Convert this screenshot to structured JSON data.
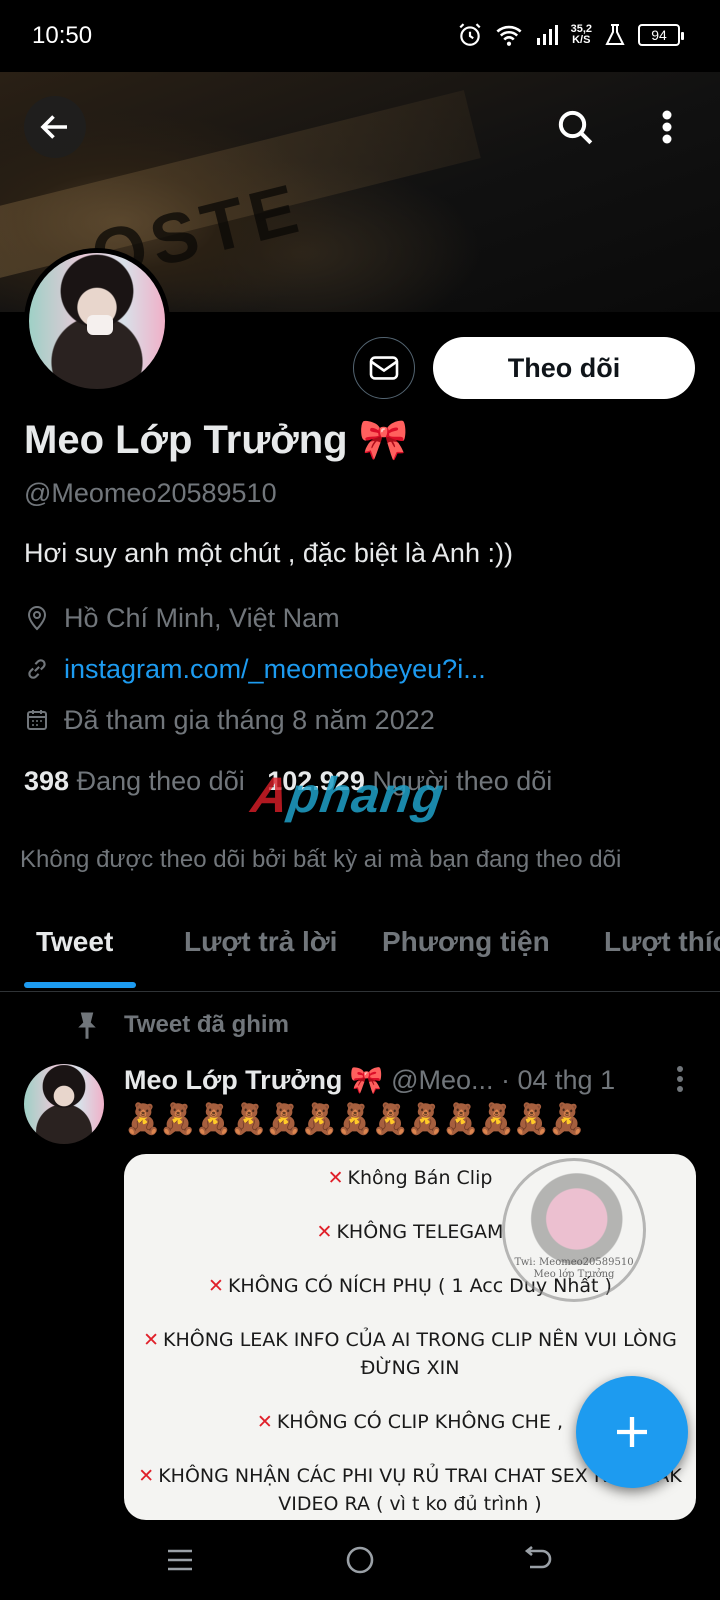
{
  "status_bar": {
    "time": "10:50",
    "net_speed_value": "35,2",
    "net_speed_unit": "K/S",
    "battery": "94",
    "icons": [
      "alarm-icon",
      "wifi-icon",
      "signal-icon",
      "flask-icon",
      "battery-icon"
    ]
  },
  "header": {
    "banner_text": "OSTE",
    "back_icon": "arrow-left-icon",
    "search_icon": "search-icon",
    "more_icon": "more-vertical-icon"
  },
  "profile": {
    "name": "Meo Lớp Trưởng 🎀",
    "handle": "@Meomeo20589510",
    "bio": "Hơi suy anh một chút , đặc biệt là Anh :))",
    "location": "Hồ Chí Minh, Việt Nam",
    "link": "instagram.com/_meomeobeyeu?i...",
    "joined": "Đã tham gia tháng 8 năm 2022",
    "following_count": "398",
    "following_label": "Đang theo dõi",
    "followers_count": "102.929",
    "followers_label": "Người theo dõi",
    "not_followed_note": "Không được theo dõi bởi bất kỳ ai mà bạn đang theo dõi",
    "follow_button": "Theo dõi"
  },
  "watermark": {
    "part1": "A",
    "part2": "phang"
  },
  "tabs": [
    {
      "label": "Tweet",
      "active": true
    },
    {
      "label": "Lượt trả lời",
      "active": false
    },
    {
      "label": "Phương tiện",
      "active": false
    },
    {
      "label": "Lượt thích",
      "active": false
    }
  ],
  "pinned_tweet": {
    "pinned_label": "Tweet đã ghim",
    "author_name": "Meo Lớp Trưởng 🎀",
    "author_handle": "@Meo...",
    "date": "· 04 thg 1",
    "text": "🧸🧸🧸🧸🧸🧸🧸🧸🧸🧸🧸🧸🧸",
    "media_lines": [
      "Không Bán Clip",
      "KHÔNG TELEGAM",
      "KHÔNG CÓ NÍCH PHỤ ( 1 Acc Duy Nhất )",
      "KHÔNG LEAK INFO CỦA AI TRONG CLIP NÊN VUI LÒNG",
      "ĐỪNG XIN",
      "KHÔNG CÓ CLIP KHÔNG CHE ,",
      "KHÔNG NHẬN CÁC PHI VỤ RỦ TRAI CHAT SEX RỒI LEAK",
      "VIDEO RA ( vì t ko đủ trình )"
    ],
    "stamp_line1": "Twi: Meomeo20589510",
    "stamp_line2": "Meo lớp Trưởng"
  },
  "colors": {
    "background": "#000000",
    "accent": "#1d9bf0",
    "text_primary": "#e7e9ea",
    "text_secondary": "#71767b"
  },
  "nav_bar": {
    "icons": [
      "recents-icon",
      "home-icon",
      "back-icon"
    ]
  }
}
